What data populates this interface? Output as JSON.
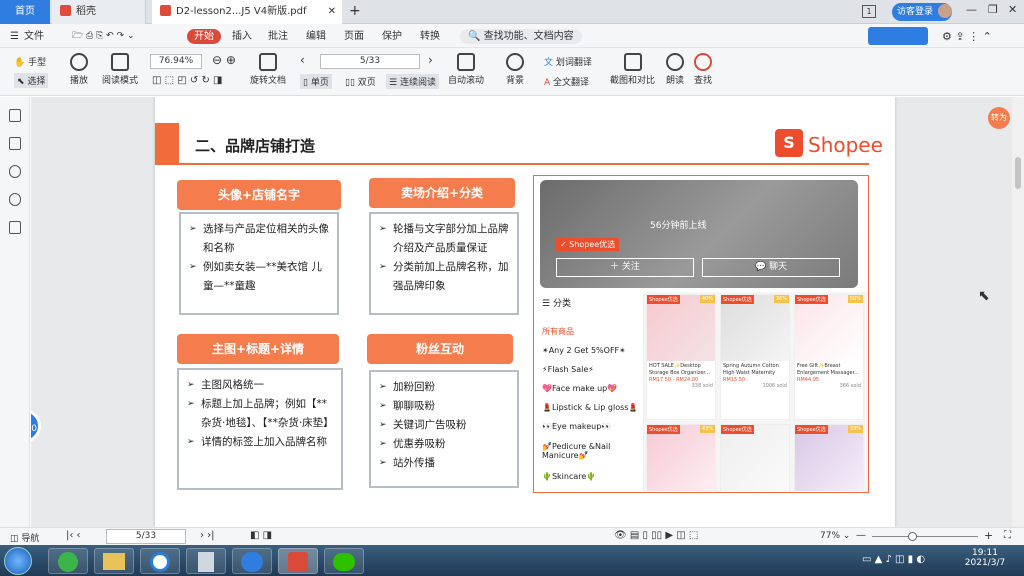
{
  "tabs": {
    "home": "首页",
    "wps": "稻壳",
    "pdf": "D2-lesson2...J5 V4新版.pdf",
    "login": "访客登录"
  },
  "menu": {
    "file": "文件",
    "start": "开始",
    "insert": "插入",
    "annotate": "批注",
    "edit": "编辑",
    "page": "页面",
    "protect": "保护",
    "convert": "转换",
    "search": "查找功能、文档内容"
  },
  "toolbar": {
    "hand": "手型",
    "select": "选择",
    "play": "播放",
    "read": "阅读模式",
    "zoom": "76.94%",
    "rotate": "旋转文档",
    "page_input": "5/33",
    "single": "单页",
    "double": "双页",
    "continuous": "连续阅读",
    "autoscroll": "自动滚动",
    "bg": "背景",
    "word_translate": "划词翻译",
    "full_translate": "全文翻译",
    "screenshot": "截图和对比",
    "read_aloud": "朗读",
    "find": "查找"
  },
  "floating": {
    "timer": "00:00",
    "convert": "转为"
  },
  "slide": {
    "title": "二、品牌店铺打造",
    "logo": "Shopee",
    "box1": {
      "title": "头像+店铺名字",
      "items": [
        "选择与产品定位相关的头像和名称",
        "例如卖女装—**美衣馆 儿童—**童趣"
      ]
    },
    "box2": {
      "title": "卖场介绍+分类",
      "items": [
        "轮播与文字部分加上品牌介绍及产品质量保证",
        "分类前加上品牌名称，加强品牌印象"
      ]
    },
    "box3": {
      "title": "主图+标题+详情",
      "items": [
        "主图风格统一",
        "标题上加上品牌；例如【**杂货·地毯】、【**杂货·床垫】",
        "详情的标签上加入品牌名称"
      ]
    },
    "box4": {
      "title": "粉丝互动",
      "items": [
        "加粉回粉",
        "聊聊吸粉",
        "关键词广告吸粉",
        "优惠券吸粉",
        "站外传播"
      ]
    },
    "shop": {
      "online": "56分钟前上线",
      "badge": "Shopee优选",
      "follow": "关注",
      "chat": "聊天",
      "cat_title": "分类",
      "categories": [
        "所有商品",
        "✴Any 2 Get 5%OFF✴",
        "⚡Flash Sale⚡",
        "💖Face make up💖",
        "💄Lipstick & Lip gloss💄",
        "👀Eye makeup👀",
        "💅Pedicure &Nail Manicure💅",
        "🌵Skincare🌵"
      ],
      "products": [
        {
          "name": "HOT SALE✨Desktop Storage Box Organizer...",
          "price": "RM17.50 - RM24.00",
          "sold": "338 sold",
          "pct": "40%"
        },
        {
          "name": "Spring Autumn Cotton High Waist Maternity Legging...",
          "price": "RM15.50",
          "sold": "1006 sold",
          "pct": "36%"
        },
        {
          "name": "Free Gift✨Breast Enlargement Massager...",
          "price": "RM44.95",
          "sold": "366 sold",
          "pct": "50%"
        },
        {
          "name": "",
          "price": "",
          "sold": "",
          "pct": "43%"
        },
        {
          "name": "",
          "price": "",
          "sold": "",
          "pct": ""
        },
        {
          "name": "",
          "price": "",
          "sold": "",
          "pct": "33%"
        }
      ]
    }
  },
  "status": {
    "nav": "导航",
    "page": "5/33",
    "zoom": "77%"
  },
  "taskbar": {
    "time": "19:11",
    "date": "2021/3/7"
  }
}
